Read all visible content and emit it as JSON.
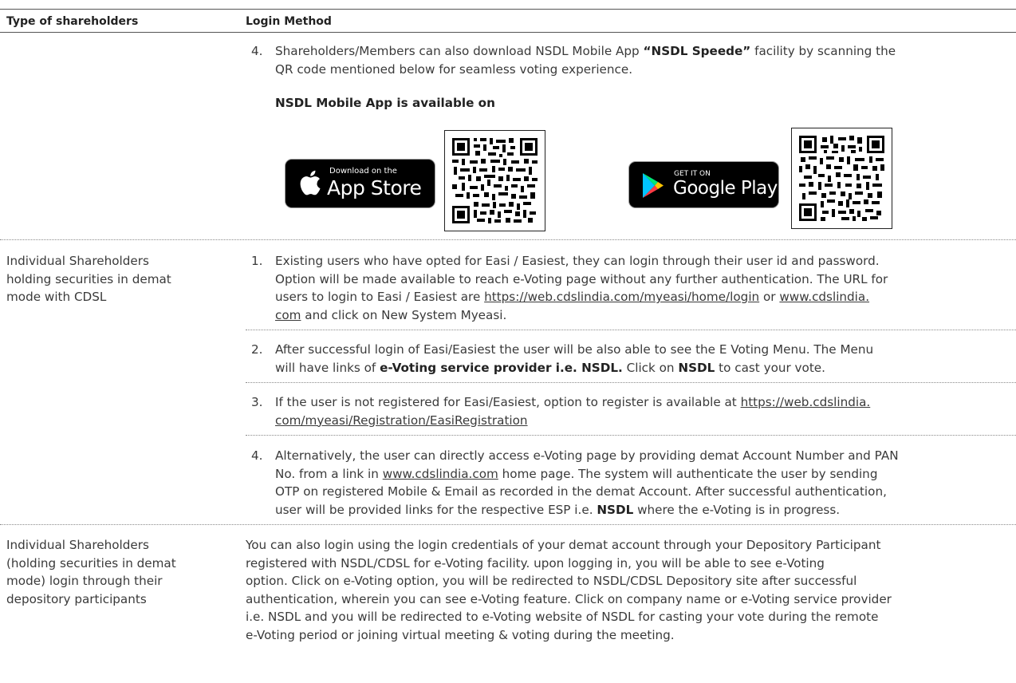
{
  "table": {
    "header": {
      "col1": "Type of shareholders",
      "col2": "Login Method"
    }
  },
  "nsdl": {
    "item4": {
      "num": "4.",
      "line1_pre": "Shareholders/Members can also download NSDL Mobile App ",
      "line1_bold": "“NSDL Speede”",
      "line1_post": " facility by scanning the",
      "line2": "QR code mentioned below for seamless voting experience."
    },
    "app_available": "NSDL Mobile App is available on",
    "appstore": {
      "small": "Download on the",
      "big": "App Store",
      "icon": "apple-icon"
    },
    "googleplay": {
      "small": "GET IT ON",
      "big": "Google Play",
      "icon": "google-play-icon"
    }
  },
  "cdsl": {
    "label": [
      "Individual Shareholders",
      "holding securities in demat",
      "mode with CDSL"
    ],
    "item1": {
      "num": "1.",
      "line1": "Existing users who have opted for Easi / Easiest, they can login through their user id and password.",
      "line2": "Option will be made available to reach e-Voting page without any further authentication. The URL for",
      "line3_pre": "users to login to Easi / Easiest are ",
      "line3_link1": "https://web.cdslindia.com/myeasi/home/login",
      "line3_mid": " or ",
      "line3_link2": "www.cdslindia.",
      "line4_link": "com",
      "line4_post": " and click on New System Myeasi."
    },
    "item2": {
      "num": "2.",
      "line1": "After successful login of Easi/Easiest the user will be also able to see the E Voting Menu. The Menu",
      "line2_pre": "will have links of ",
      "line2_bold1": "e-Voting service provider i.e. NSDL.",
      "line2_mid": " Click on ",
      "line2_bold2": "NSDL",
      "line2_post": " to cast your vote."
    },
    "item3": {
      "num": "3.",
      "line1_pre": "If the user is not  registered for Easi/Easiest, option to register is available at ",
      "line1_link": "https://web.cdslindia.",
      "line2_link": "com/myeasi/Registration/EasiRegistration"
    },
    "item4": {
      "num": "4.",
      "line1": "Alternatively, the user can directly access e-Voting page by providing demat Account Number and PAN",
      "line2_pre": "No. from a link in ",
      "line2_link": "www.cdslindia.com",
      "line2_post": " home page. The system will authenticate the user by sending",
      "line3": "OTP on registered Mobile & Email as recorded in the demat Account. After successful authentication,",
      "line4_pre": "user will be provided links for the respective ESP i.e. ",
      "line4_bold": "NSDL",
      "line4_post": " where the e-Voting is in progress."
    }
  },
  "dp": {
    "label": [
      "Individual Shareholders",
      "(holding securities in demat",
      "mode) login through their",
      "depository participants"
    ],
    "lines": [
      "You can also login using the login credentials of your demat account through your Depository Participant",
      "registered with NSDL/CDSL for e-Voting facility. upon logging in, you will be able to see e-Voting",
      "option. Click on e-Voting option, you will be redirected to NSDL/CDSL Depository site after successful",
      "authentication, wherein you can see e-Voting feature. Click on company name or e-Voting service provider",
      "i.e. NSDL and you will be redirected to e-Voting website of NSDL for casting your vote during the remote",
      "e-Voting period or joining virtual meeting & voting during the meeting."
    ]
  }
}
